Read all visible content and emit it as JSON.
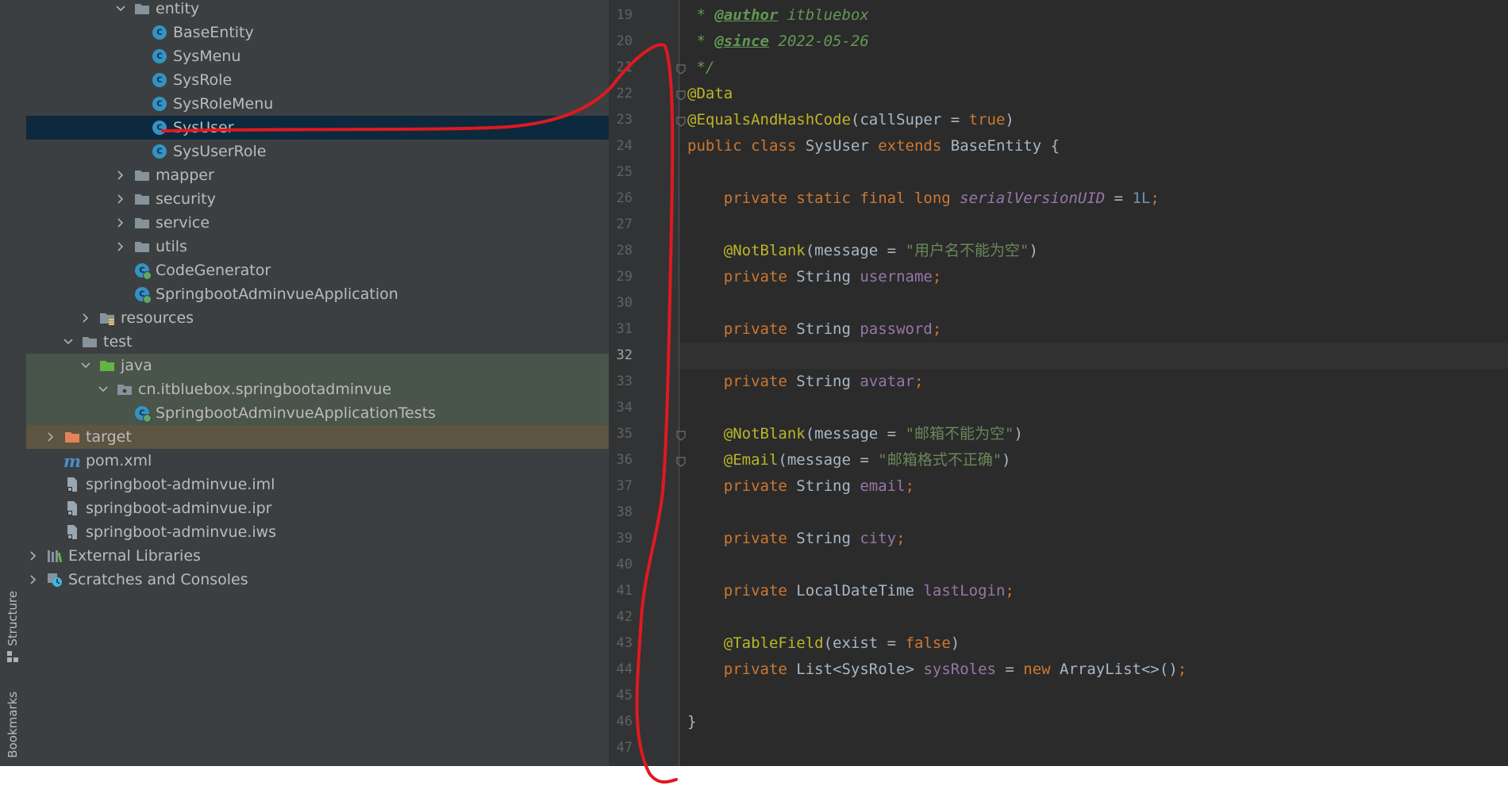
{
  "toolstrip": {
    "structure_label": "Structure",
    "bookmarks_label": "Bookmarks"
  },
  "tree": {
    "items": [
      {
        "label": "entity",
        "depth": 5,
        "chevron": "down",
        "icon": "folder"
      },
      {
        "label": "BaseEntity",
        "depth": 6,
        "chevron": "none",
        "icon": "class"
      },
      {
        "label": "SysMenu",
        "depth": 6,
        "chevron": "none",
        "icon": "class"
      },
      {
        "label": "SysRole",
        "depth": 6,
        "chevron": "none",
        "icon": "class"
      },
      {
        "label": "SysRoleMenu",
        "depth": 6,
        "chevron": "none",
        "icon": "class"
      },
      {
        "label": "SysUser",
        "depth": 6,
        "chevron": "none",
        "icon": "class",
        "selected": true
      },
      {
        "label": "SysUserRole",
        "depth": 6,
        "chevron": "none",
        "icon": "class"
      },
      {
        "label": "mapper",
        "depth": 5,
        "chevron": "right",
        "icon": "folder"
      },
      {
        "label": "security",
        "depth": 5,
        "chevron": "right",
        "icon": "folder"
      },
      {
        "label": "service",
        "depth": 5,
        "chevron": "right",
        "icon": "folder"
      },
      {
        "label": "utils",
        "depth": 5,
        "chevron": "right",
        "icon": "folder"
      },
      {
        "label": "CodeGenerator",
        "depth": 5,
        "chevron": "none",
        "icon": "class-run"
      },
      {
        "label": "SpringbootAdminvueApplication",
        "depth": 5,
        "chevron": "none",
        "icon": "class-run"
      },
      {
        "label": "resources",
        "depth": 3,
        "chevron": "right",
        "icon": "resources-folder"
      },
      {
        "label": "test",
        "depth": 2,
        "chevron": "down",
        "icon": "folder"
      },
      {
        "label": "java",
        "depth": 3,
        "chevron": "down",
        "icon": "test-folder",
        "tint": "test"
      },
      {
        "label": "cn.itbluebox.springbootadminvue",
        "depth": 4,
        "chevron": "down",
        "icon": "package",
        "tint": "test"
      },
      {
        "label": "SpringbootAdminvueApplicationTests",
        "depth": 5,
        "chevron": "none",
        "icon": "class-run",
        "tint": "test"
      },
      {
        "label": "target",
        "depth": 1,
        "chevron": "right",
        "icon": "excluded-folder",
        "tint": "excluded"
      },
      {
        "label": "pom.xml",
        "depth": 1,
        "chevron": "none",
        "icon": "maven"
      },
      {
        "label": "springboot-adminvue.iml",
        "depth": 1,
        "chevron": "none",
        "icon": "file"
      },
      {
        "label": "springboot-adminvue.ipr",
        "depth": 1,
        "chevron": "none",
        "icon": "file"
      },
      {
        "label": "springboot-adminvue.iws",
        "depth": 1,
        "chevron": "none",
        "icon": "file"
      },
      {
        "label": "External Libraries",
        "depth": 0,
        "chevron": "right",
        "icon": "libraries"
      },
      {
        "label": "Scratches and Consoles",
        "depth": 0,
        "chevron": "right",
        "icon": "scratches"
      }
    ]
  },
  "editor": {
    "current_line": "32",
    "lines": [
      {
        "n": "19",
        "tokens": [
          {
            "t": " * ",
            "c": "doc"
          },
          {
            "t": "@author",
            "c": "doctag"
          },
          {
            "t": " itbluebox",
            "c": "doc"
          }
        ]
      },
      {
        "n": "20",
        "tokens": [
          {
            "t": " * ",
            "c": "doc"
          },
          {
            "t": "@since",
            "c": "doctag"
          },
          {
            "t": " 2022-05-26",
            "c": "doc"
          }
        ]
      },
      {
        "n": "21",
        "tokens": [
          {
            "t": " */",
            "c": "doc"
          }
        ]
      },
      {
        "n": "22",
        "tokens": [
          {
            "t": "@Data",
            "c": "ann"
          }
        ]
      },
      {
        "n": "23",
        "tokens": [
          {
            "t": "@EqualsAndHashCode",
            "c": "ann"
          },
          {
            "t": "(callSuper = ",
            "c": "plain"
          },
          {
            "t": "true",
            "c": "kw"
          },
          {
            "t": ")",
            "c": "plain"
          }
        ]
      },
      {
        "n": "24",
        "tokens": [
          {
            "t": "public class ",
            "c": "kw"
          },
          {
            "t": "SysUser ",
            "c": "plain"
          },
          {
            "t": "extends ",
            "c": "kw"
          },
          {
            "t": "BaseEntity {",
            "c": "plain"
          }
        ]
      },
      {
        "n": "25",
        "tokens": []
      },
      {
        "n": "26",
        "tokens": [
          {
            "t": "    private static final long ",
            "c": "kw"
          },
          {
            "t": "serialVersionUID",
            "c": "sfld"
          },
          {
            "t": " = ",
            "c": "plain"
          },
          {
            "t": "1L",
            "c": "num"
          },
          {
            "t": ";",
            "c": "kw"
          }
        ]
      },
      {
        "n": "27",
        "tokens": []
      },
      {
        "n": "28",
        "tokens": [
          {
            "t": "    ",
            "c": "plain"
          },
          {
            "t": "@NotBlank",
            "c": "ann"
          },
          {
            "t": "(message = ",
            "c": "plain"
          },
          {
            "t": "\"用户名不能为空\"",
            "c": "str"
          },
          {
            "t": ")",
            "c": "plain"
          }
        ]
      },
      {
        "n": "29",
        "tokens": [
          {
            "t": "    private ",
            "c": "kw"
          },
          {
            "t": "String ",
            "c": "plain"
          },
          {
            "t": "username",
            "c": "fld"
          },
          {
            "t": ";",
            "c": "kw"
          }
        ]
      },
      {
        "n": "30",
        "tokens": []
      },
      {
        "n": "31",
        "tokens": [
          {
            "t": "    private ",
            "c": "kw"
          },
          {
            "t": "String ",
            "c": "plain"
          },
          {
            "t": "password",
            "c": "fld"
          },
          {
            "t": ";",
            "c": "kw"
          }
        ]
      },
      {
        "n": "32",
        "tokens": []
      },
      {
        "n": "33",
        "tokens": [
          {
            "t": "    private ",
            "c": "kw"
          },
          {
            "t": "String ",
            "c": "plain"
          },
          {
            "t": "avatar",
            "c": "fld"
          },
          {
            "t": ";",
            "c": "kw"
          }
        ]
      },
      {
        "n": "34",
        "tokens": []
      },
      {
        "n": "35",
        "tokens": [
          {
            "t": "    ",
            "c": "plain"
          },
          {
            "t": "@NotBlank",
            "c": "ann"
          },
          {
            "t": "(message = ",
            "c": "plain"
          },
          {
            "t": "\"邮箱不能为空\"",
            "c": "str"
          },
          {
            "t": ")",
            "c": "plain"
          }
        ]
      },
      {
        "n": "36",
        "tokens": [
          {
            "t": "    ",
            "c": "plain"
          },
          {
            "t": "@Email",
            "c": "ann"
          },
          {
            "t": "(message = ",
            "c": "plain"
          },
          {
            "t": "\"邮箱格式不正确\"",
            "c": "str"
          },
          {
            "t": ")",
            "c": "plain"
          }
        ]
      },
      {
        "n": "37",
        "tokens": [
          {
            "t": "    private ",
            "c": "kw"
          },
          {
            "t": "String ",
            "c": "plain"
          },
          {
            "t": "email",
            "c": "fld"
          },
          {
            "t": ";",
            "c": "kw"
          }
        ]
      },
      {
        "n": "38",
        "tokens": []
      },
      {
        "n": "39",
        "tokens": [
          {
            "t": "    private ",
            "c": "kw"
          },
          {
            "t": "String ",
            "c": "plain"
          },
          {
            "t": "city",
            "c": "fld"
          },
          {
            "t": ";",
            "c": "kw"
          }
        ]
      },
      {
        "n": "40",
        "tokens": []
      },
      {
        "n": "41",
        "tokens": [
          {
            "t": "    private ",
            "c": "kw"
          },
          {
            "t": "LocalDateTime ",
            "c": "plain"
          },
          {
            "t": "lastLogin",
            "c": "fld"
          },
          {
            "t": ";",
            "c": "kw"
          }
        ]
      },
      {
        "n": "42",
        "tokens": []
      },
      {
        "n": "43",
        "tokens": [
          {
            "t": "    ",
            "c": "plain"
          },
          {
            "t": "@TableField",
            "c": "ann"
          },
          {
            "t": "(exist = ",
            "c": "plain"
          },
          {
            "t": "false",
            "c": "kw"
          },
          {
            "t": ")",
            "c": "plain"
          }
        ]
      },
      {
        "n": "44",
        "tokens": [
          {
            "t": "    private ",
            "c": "kw"
          },
          {
            "t": "List<SysRole> ",
            "c": "plain"
          },
          {
            "t": "sysRoles",
            "c": "fld"
          },
          {
            "t": " = ",
            "c": "plain"
          },
          {
            "t": "new ",
            "c": "kw"
          },
          {
            "t": "ArrayList<>()",
            "c": "plain"
          },
          {
            "t": ";",
            "c": "kw"
          }
        ]
      },
      {
        "n": "45",
        "tokens": []
      },
      {
        "n": "46",
        "tokens": [
          {
            "t": "}",
            "c": "plain"
          }
        ]
      },
      {
        "n": "47",
        "tokens": []
      }
    ],
    "fold_markers_at_lines": [
      "21",
      "22",
      "23",
      "35",
      "36"
    ]
  },
  "colors": {
    "panel_bg": "#3c3f41",
    "editor_bg": "#2b2b2b",
    "selection": "#0d293e",
    "annotation_stroke": "#e0191f"
  }
}
